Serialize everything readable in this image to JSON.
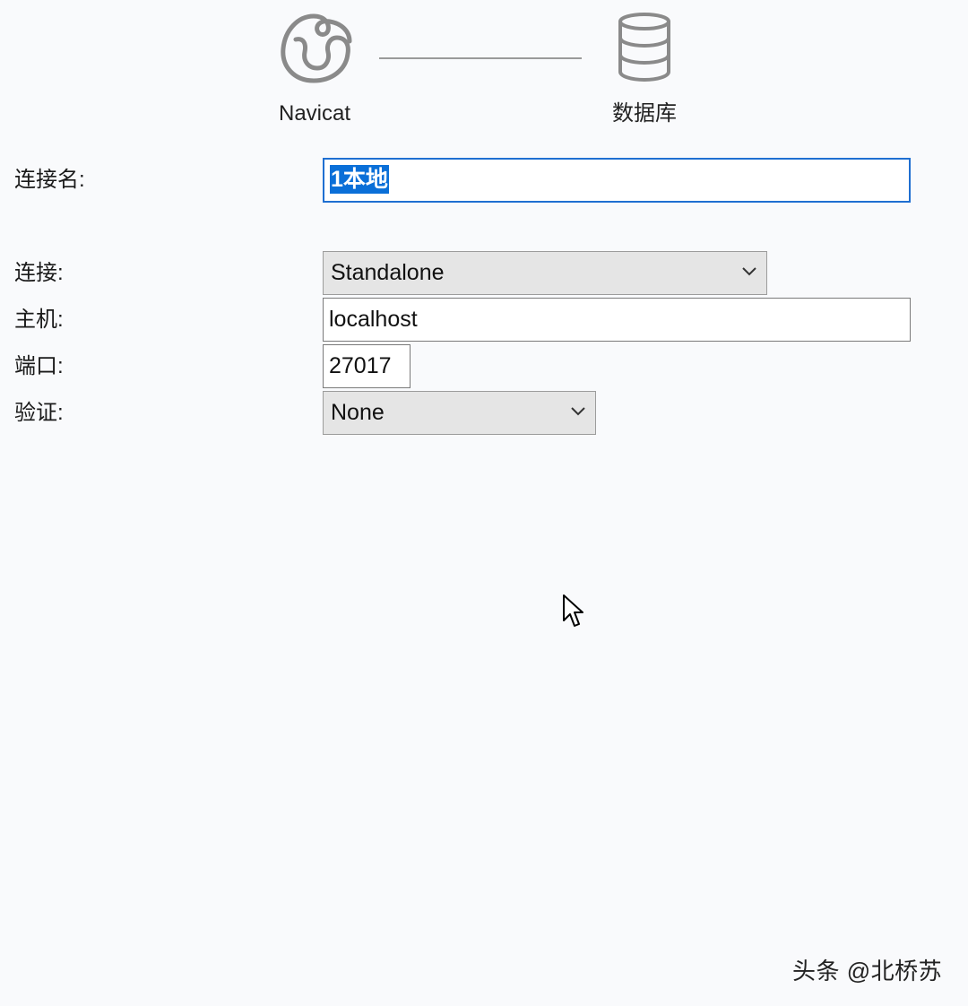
{
  "header": {
    "source_label": "Navicat",
    "target_label": "数据库",
    "source_icon": "navicat-logo-icon",
    "target_icon": "database-icon"
  },
  "form": {
    "connection_name": {
      "label": "连接名:",
      "value": "1本地"
    },
    "connection": {
      "label": "连接:",
      "selected": "Standalone"
    },
    "host": {
      "label": "主机:",
      "value": "localhost"
    },
    "port": {
      "label": "端口:",
      "value": "27017"
    },
    "auth": {
      "label": "验证:",
      "selected": "None"
    }
  },
  "watermark": "头条 @北桥苏",
  "colors": {
    "background": "#f9fafc",
    "focus_border": "#1f6fd1",
    "selection": "#0a6fd8",
    "select_bg": "#e5e5e5"
  }
}
